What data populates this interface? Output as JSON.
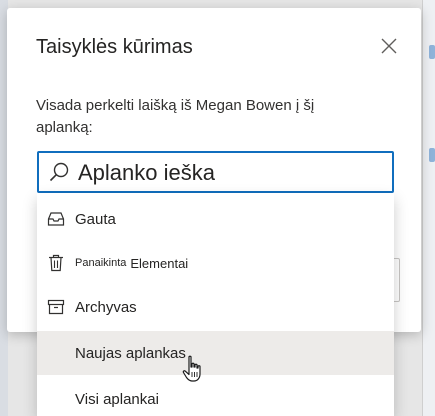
{
  "dialog": {
    "title": "Taisyklės kūrimas",
    "text": "Visada perkelti laišką iš Megan Bowen į šį aplanką:"
  },
  "search": {
    "value": "Aplanko ieška"
  },
  "folders": [
    {
      "label": "Gauta",
      "icon": "inbox-icon"
    },
    {
      "label_small": "Panaikinta",
      "label_after": "Elementai",
      "icon": "trash-icon"
    },
    {
      "label": "Archyvas",
      "icon": "archive-icon"
    },
    {
      "label": "Naujas aplankas",
      "icon": "none"
    },
    {
      "label": "Visi aplankai",
      "icon": "none"
    }
  ],
  "colors": {
    "accent": "#106ebe",
    "hover": "#edebe9"
  }
}
